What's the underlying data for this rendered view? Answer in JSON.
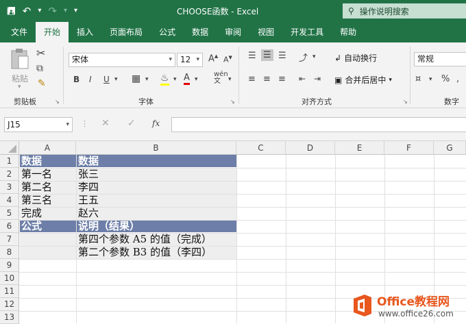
{
  "window": {
    "title": "CHOOSE函数 - Excel",
    "tell_me": "操作说明搜索"
  },
  "menu": [
    "文件",
    "开始",
    "插入",
    "页面布局",
    "公式",
    "数据",
    "审阅",
    "视图",
    "开发工具",
    "帮助"
  ],
  "ribbon": {
    "paste": "粘贴",
    "clipboard_group": "剪贴板",
    "font_name": "宋体",
    "font_size": "12",
    "bold": "B",
    "italic": "I",
    "underline": "U",
    "font_group": "字体",
    "wrap_text": "自动换行",
    "merge_center": "合并后居中",
    "alignment_group": "对齐方式",
    "number_format": "常规",
    "percent": "%",
    "number_group": "数字"
  },
  "formula_bar": {
    "name_box": "J15",
    "fx": "fx",
    "value": ""
  },
  "columns": [
    "A",
    "B",
    "C",
    "D",
    "E",
    "F",
    "G"
  ],
  "rows": [
    "1",
    "2",
    "3",
    "4",
    "5",
    "6",
    "7",
    "8",
    "9",
    "10",
    "11",
    "12",
    "13"
  ],
  "cells": {
    "A1": "数据",
    "B1": "数据",
    "A2": "第一名",
    "B2": "张三",
    "A3": "第二名",
    "B3": "李四",
    "A4": "第三名",
    "B4": "王五",
    "A5": "完成",
    "B5": "赵六",
    "A6": "公式",
    "B6": "说明（结果）",
    "B7": "第四个参数 A5 的值（完成）",
    "B8": "第二个参数 B3 的值（李四）"
  },
  "watermark": {
    "brand": "Office教程网",
    "url": "www.office26.com"
  },
  "colors": {
    "excel_green": "#217346",
    "header_band": "#6d7fa8",
    "logo_orange": "#e8571e"
  }
}
